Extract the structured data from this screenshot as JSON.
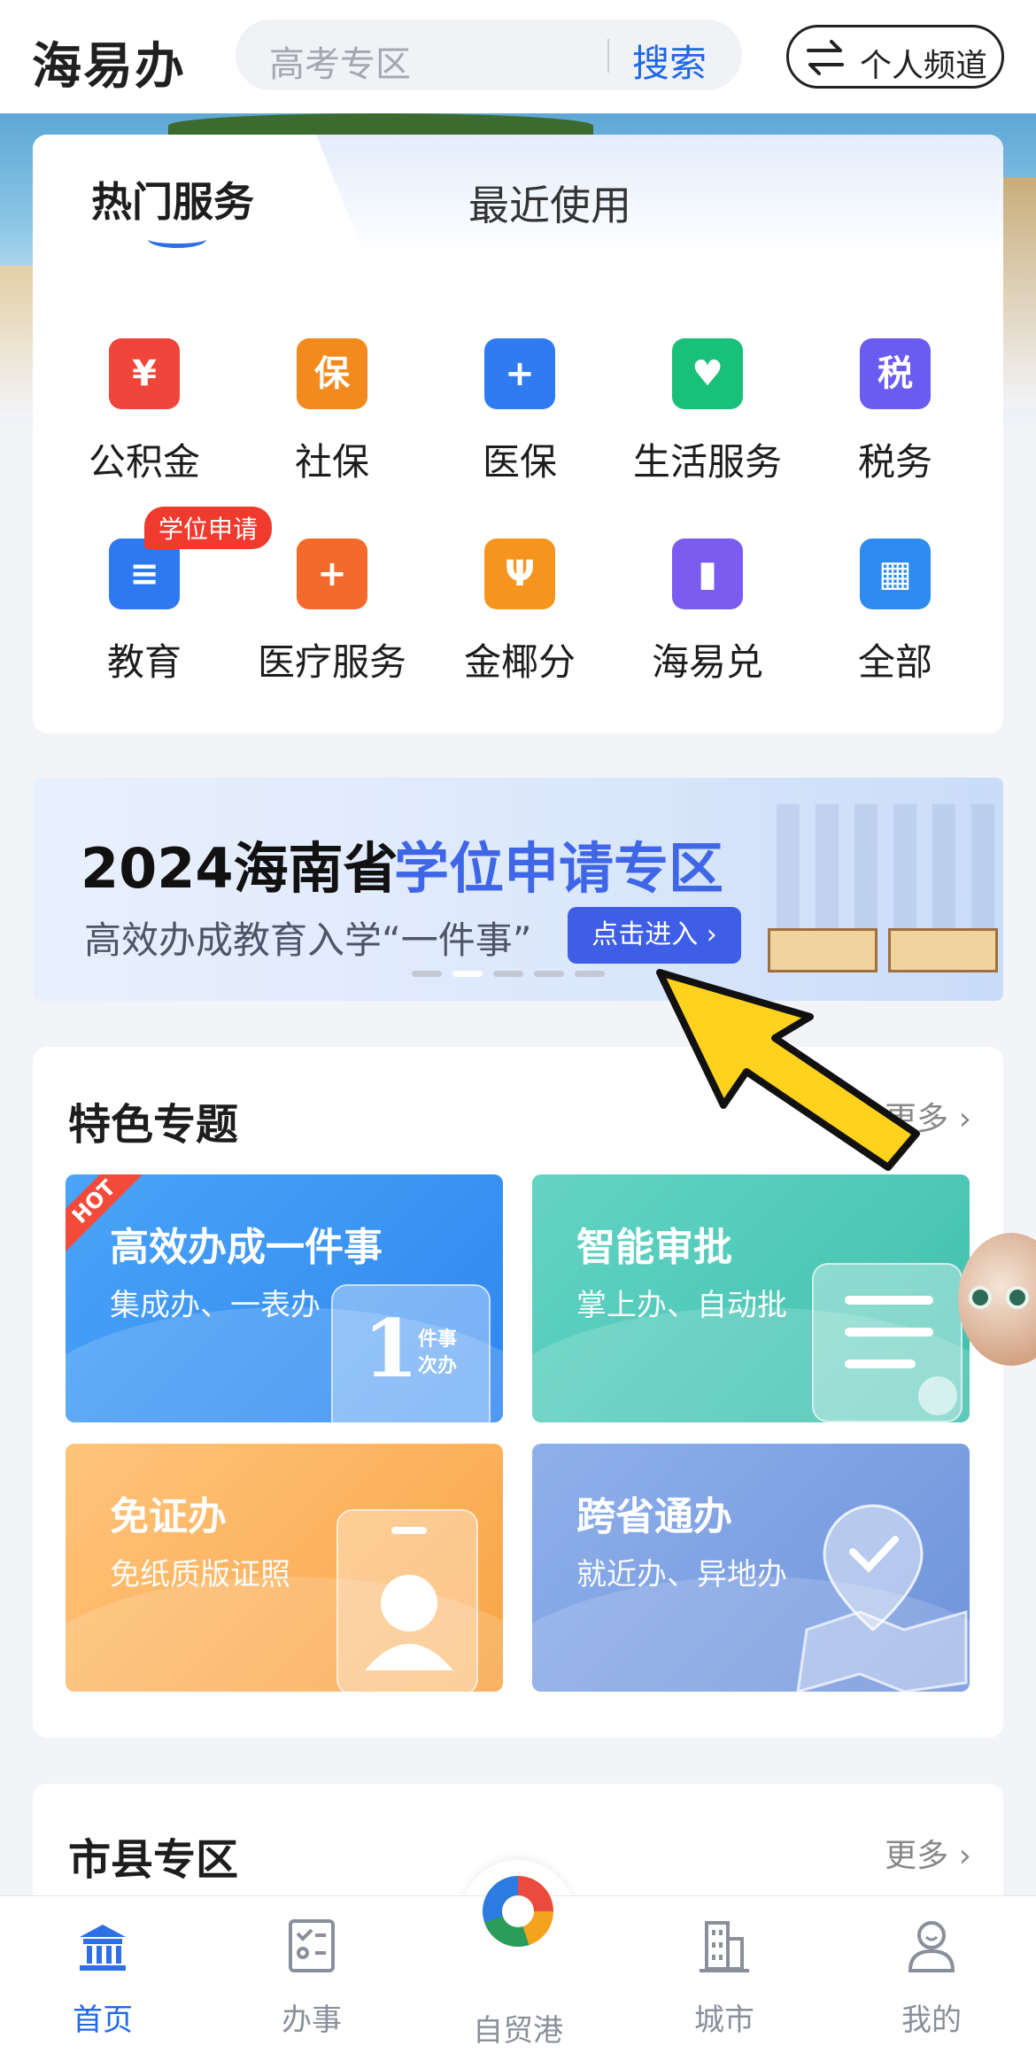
{
  "header": {
    "brand": "海易办",
    "search_placeholder": "高考专区",
    "search_button": "搜索",
    "channel_button": "个人频道",
    "channel_icon": "swap-arrows-icon"
  },
  "services": {
    "tabs": [
      "热门服务",
      "最近使用"
    ],
    "items": [
      {
        "label": "公积金",
        "icon": "house-yuan-icon",
        "color": "#f0453a",
        "glyph": "¥"
      },
      {
        "label": "社保",
        "icon": "shield-bao-icon",
        "color": "#f28a1e",
        "glyph": "保"
      },
      {
        "label": "医保",
        "icon": "card-plus-icon",
        "color": "#2f7cf0",
        "glyph": "+"
      },
      {
        "label": "生活服务",
        "icon": "home-heart-icon",
        "color": "#18c07a",
        "glyph": "♥"
      },
      {
        "label": "税务",
        "icon": "hand-tax-icon",
        "color": "#6a5cf0",
        "glyph": "税"
      },
      {
        "label": "教育",
        "icon": "education-board-icon",
        "color": "#2e78f0",
        "glyph": "≡",
        "badge": "学位申请"
      },
      {
        "label": "医疗服务",
        "icon": "medical-kit-icon",
        "color": "#f46a2a",
        "glyph": "+"
      },
      {
        "label": "金椰分",
        "icon": "palm-tree-icon",
        "color": "#f5951e",
        "glyph": "Ψ"
      },
      {
        "label": "海易兑",
        "icon": "document-person-icon",
        "color": "#7b5cf0",
        "glyph": "▮"
      },
      {
        "label": "全部",
        "icon": "grid-all-icon",
        "color": "#2e8cf0",
        "glyph": "▦"
      }
    ]
  },
  "banner": {
    "title_prefix": "2024海南省",
    "title_highlight": "学位申请专区",
    "subtitle": "高效办成教育入学“一件事”",
    "button": "点击进入 ›",
    "dots": 5,
    "active_dot": 1
  },
  "topics": {
    "title": "特色专题",
    "more": "更多 ›",
    "tiles": [
      {
        "title": "高效办成一件事",
        "subtitle": "集成办、一表办",
        "colors": [
          "#4aa4f7",
          "#2f86ef"
        ],
        "hot": "HOT",
        "glass_text": "1",
        "glass_small": "件事次办"
      },
      {
        "title": "智能审批",
        "subtitle": "掌上办、自动批",
        "colors": [
          "#64d4c4",
          "#3fbfae"
        ]
      },
      {
        "title": "免证办",
        "subtitle": "免纸质版证照",
        "colors": [
          "#ffc47c",
          "#f9a445"
        ]
      },
      {
        "title": "跨省通办",
        "subtitle": "就近办、异地办",
        "colors": [
          "#8fb0ea",
          "#6f93db"
        ]
      }
    ]
  },
  "city": {
    "title": "市县专区",
    "more": "更多 ›"
  },
  "bottom_nav": {
    "items": [
      {
        "label": "首页",
        "icon": "government-building-icon",
        "active": true
      },
      {
        "label": "办事",
        "icon": "checklist-icon",
        "active": false
      },
      {
        "label": "自贸港",
        "icon": "free-trade-port-logo-icon",
        "active": false
      },
      {
        "label": "城市",
        "icon": "city-building-icon",
        "active": false
      },
      {
        "label": "我的",
        "icon": "user-profile-icon",
        "active": false
      }
    ]
  },
  "overlay": {
    "pointer_color": "#ffd21e"
  }
}
